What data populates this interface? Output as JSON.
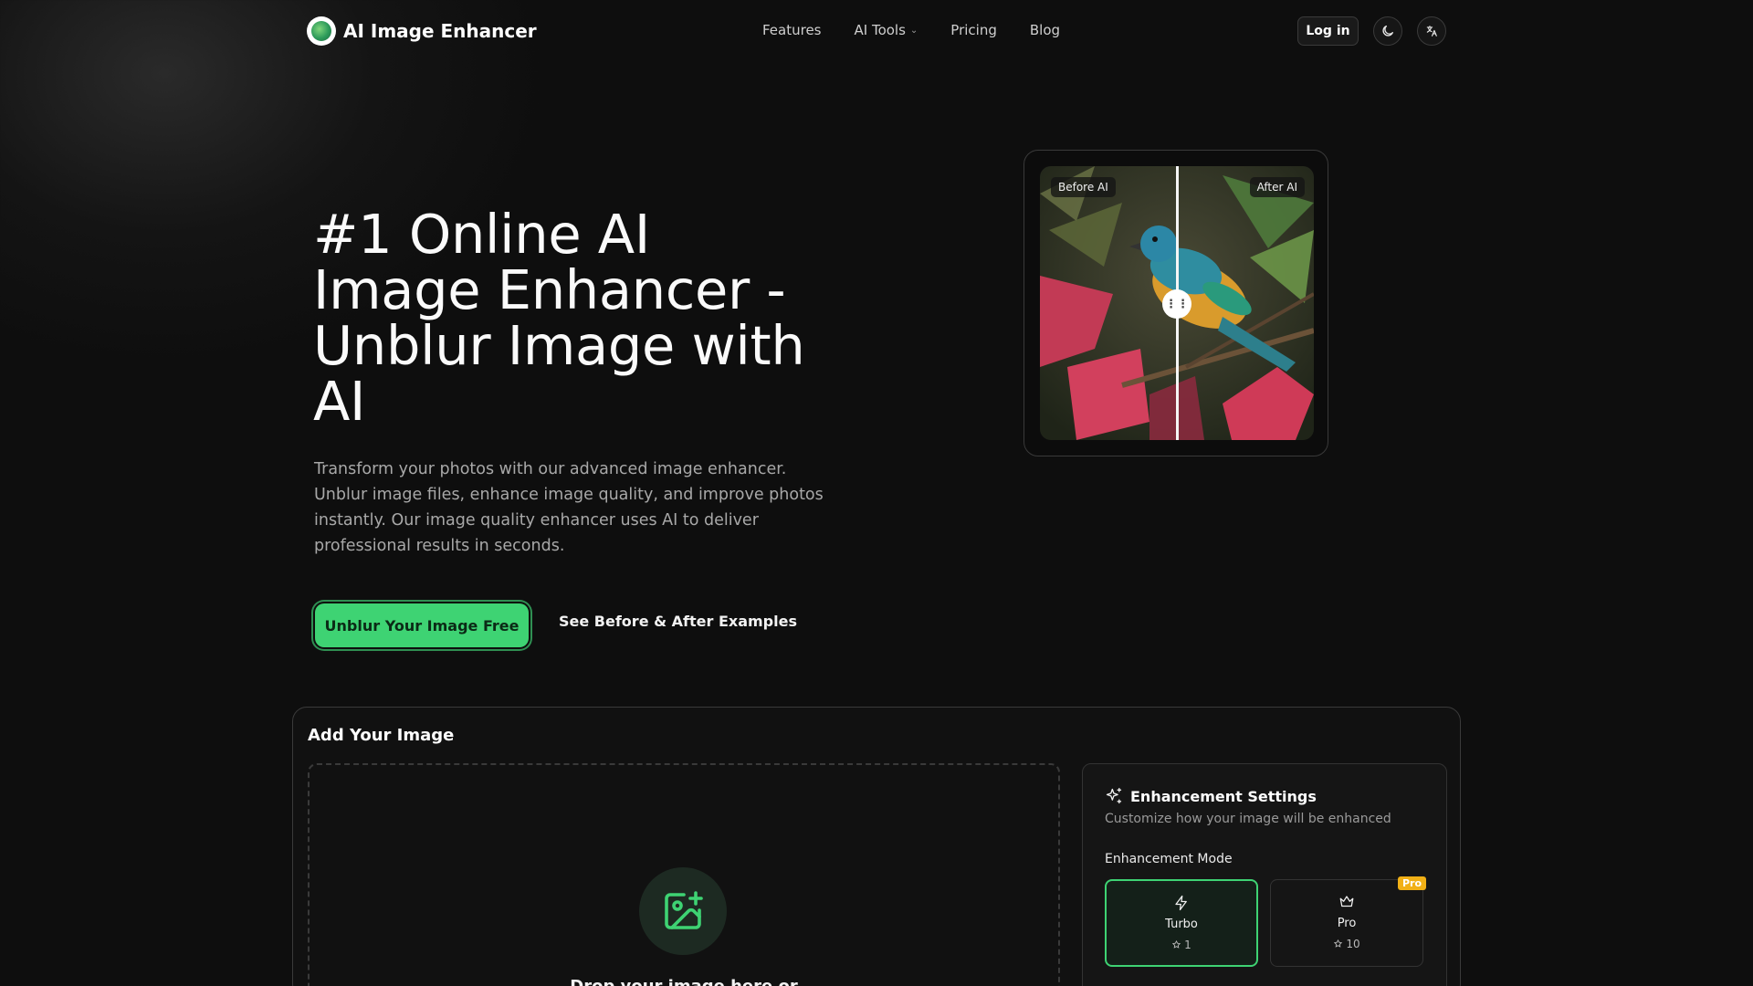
{
  "nav": {
    "brand": "AI Image Enhancer",
    "links": [
      "Features",
      "AI Tools",
      "Pricing",
      "Blog"
    ],
    "login": "Log in"
  },
  "hero": {
    "title": "#1 Online AI Image Enhancer - Unblur Image with AI",
    "description": "Transform your photos with our advanced image enhancer. Unblur image files, enhance image quality, and improve photos instantly. Our image quality enhancer uses AI to deliver professional results in seconds.",
    "cta_primary": "Unblur Your Image Free",
    "cta_secondary": "See Before & After Examples"
  },
  "compare": {
    "before_label": "Before AI",
    "after_label": "After AI"
  },
  "upload": {
    "title": "Add Your Image",
    "drop_text": "Drop your image here or"
  },
  "settings": {
    "title": "Enhancement Settings",
    "subtitle": "Customize how your image will be enhanced",
    "mode_label": "Enhancement Mode",
    "modes": [
      {
        "name": "Turbo",
        "cost": "1",
        "icon": "bolt-icon",
        "selected": true
      },
      {
        "name": "Pro",
        "cost": "10",
        "icon": "crown-icon",
        "badge": "Pro"
      }
    ]
  },
  "colors": {
    "accent": "#3ed373",
    "background": "#0e0e0e",
    "badge": "#f1b016"
  }
}
